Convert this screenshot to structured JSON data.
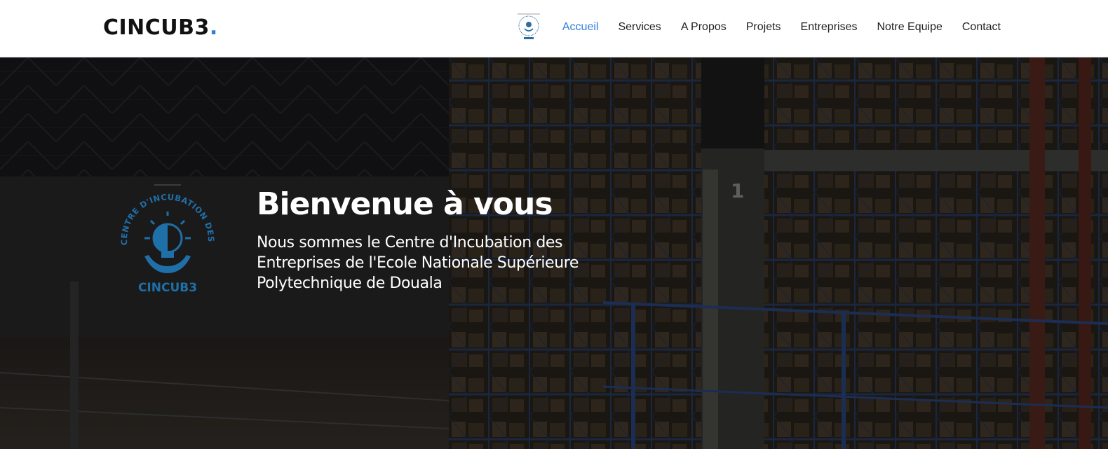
{
  "colors": {
    "accent": "#2f7fd6",
    "header_bg": "#ffffff",
    "nav_text": "#1f1f1f",
    "hero_text": "#ffffff",
    "emblem_blue": "#1f6fa8"
  },
  "header": {
    "brand": "CINCUB3",
    "brand_dot": ".",
    "nav_logo_icon": "cincub3-emblem-icon",
    "nav": [
      {
        "label": "Accueil",
        "active": true
      },
      {
        "label": "Services",
        "active": false
      },
      {
        "label": "A Propos",
        "active": false
      },
      {
        "label": "Projets",
        "active": false
      },
      {
        "label": "Entreprises",
        "active": false
      },
      {
        "label": "Notre Equipe",
        "active": false
      },
      {
        "label": "Contact",
        "active": false
      }
    ]
  },
  "hero": {
    "background": "warehouse-shelves-image",
    "emblem": {
      "icon": "cincub3-emblem-icon",
      "ring_text": "CENTRE D'INCUBATION DES ENTREPRISES",
      "word": "CINCUB3"
    },
    "title": "Bienvenue à vous",
    "subtitle": "Nous sommes le Centre d'Incubation des Entreprises de l'Ecole Nationale Supérieure Polytechnique de Douala"
  }
}
